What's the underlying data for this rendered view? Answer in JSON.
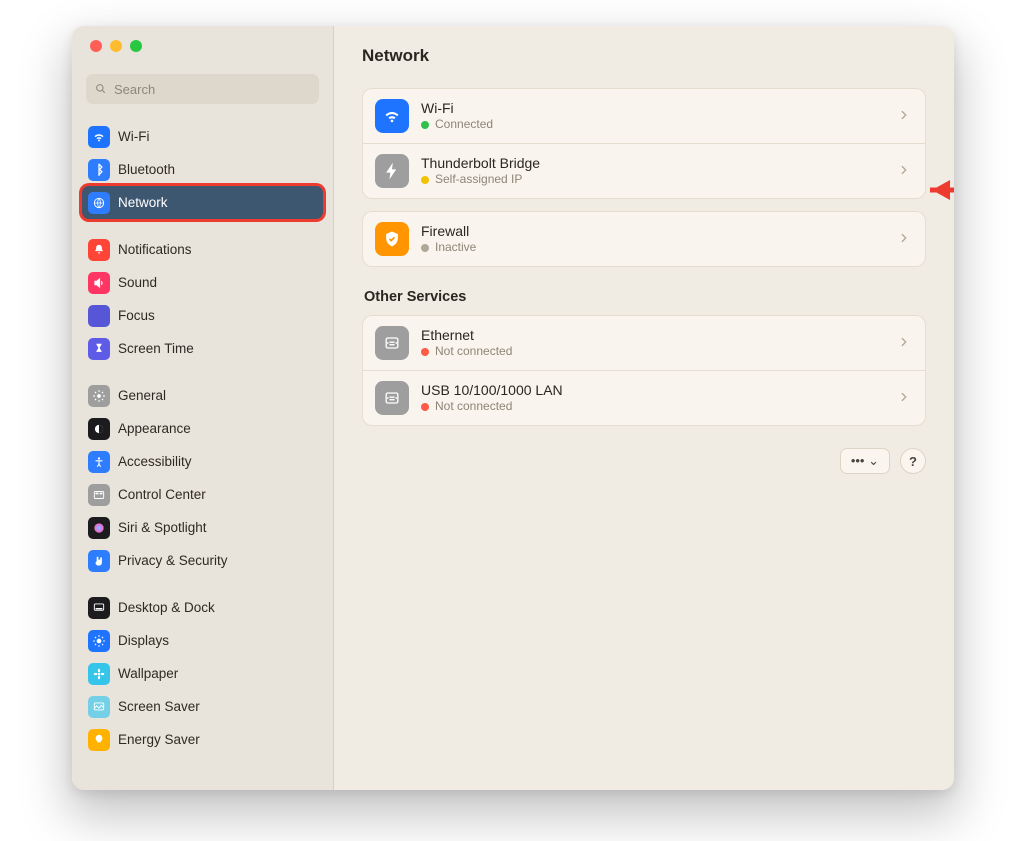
{
  "window": {
    "title": "Network"
  },
  "search": {
    "placeholder": "Search"
  },
  "sidebar_groups": [
    {
      "items": [
        {
          "label": "Wi-Fi",
          "icon": "wifi",
          "bg": "#1e74ff",
          "selected": false
        },
        {
          "label": "Bluetooth",
          "icon": "bt",
          "bg": "#2f7dff",
          "selected": false
        },
        {
          "label": "Network",
          "icon": "globe",
          "bg": "#2f7dff",
          "selected": true
        }
      ]
    },
    {
      "items": [
        {
          "label": "Notifications",
          "icon": "bell",
          "bg": "#ff4438",
          "selected": false
        },
        {
          "label": "Sound",
          "icon": "speaker",
          "bg": "#ff3563",
          "selected": false
        },
        {
          "label": "Focus",
          "icon": "moon",
          "bg": "#5756d6",
          "selected": false
        },
        {
          "label": "Screen Time",
          "icon": "hour",
          "bg": "#5e5ce6",
          "selected": false
        }
      ]
    },
    {
      "items": [
        {
          "label": "General",
          "icon": "gear",
          "bg": "#9e9e9e",
          "selected": false
        },
        {
          "label": "Appearance",
          "icon": "appear",
          "bg": "#1c1c1e",
          "selected": false
        },
        {
          "label": "Accessibility",
          "icon": "access",
          "bg": "#2f7dff",
          "selected": false
        },
        {
          "label": "Control Center",
          "icon": "cc",
          "bg": "#9e9e9e",
          "selected": false
        },
        {
          "label": "Siri & Spotlight",
          "icon": "siri",
          "bg": "#1c1c1e",
          "selected": false
        },
        {
          "label": "Privacy & Security",
          "icon": "hand",
          "bg": "#2f7dff",
          "selected": false
        }
      ]
    },
    {
      "items": [
        {
          "label": "Desktop & Dock",
          "icon": "dock",
          "bg": "#1c1c1e",
          "selected": false
        },
        {
          "label": "Displays",
          "icon": "sun",
          "bg": "#1e74ff",
          "selected": false
        },
        {
          "label": "Wallpaper",
          "icon": "flower",
          "bg": "#35c4ea",
          "selected": false
        },
        {
          "label": "Screen Saver",
          "icon": "frame",
          "bg": "#74d0e7",
          "selected": false
        },
        {
          "label": "Energy Saver",
          "icon": "bulb",
          "bg": "#ffb300",
          "selected": false
        }
      ]
    }
  ],
  "network": {
    "primary": [
      {
        "title": "Wi-Fi",
        "status": "Connected",
        "dot": "#30c04b",
        "icon": "wifi",
        "bg": "#1e74ff"
      },
      {
        "title": "Thunderbolt Bridge",
        "status": "Self-assigned IP",
        "dot": "#f2c200",
        "icon": "bolt",
        "bg": "#9e9e9e"
      }
    ],
    "firewall": [
      {
        "title": "Firewall",
        "status": "Inactive",
        "dot": "#b0a897",
        "icon": "shield",
        "bg": "#ff9500"
      }
    ],
    "other_label": "Other Services",
    "other": [
      {
        "title": "Ethernet",
        "status": "Not connected",
        "dot": "#ff5a47",
        "icon": "eth",
        "bg": "#9e9e9e"
      },
      {
        "title": "USB 10/100/1000 LAN",
        "status": "Not connected",
        "dot": "#ff5a47",
        "icon": "eth",
        "bg": "#9e9e9e"
      }
    ]
  },
  "actions": {
    "more": "••• ⌄",
    "help": "?"
  },
  "colors": {
    "selection": "#3e5771",
    "annotation": "#ee3b2f"
  }
}
